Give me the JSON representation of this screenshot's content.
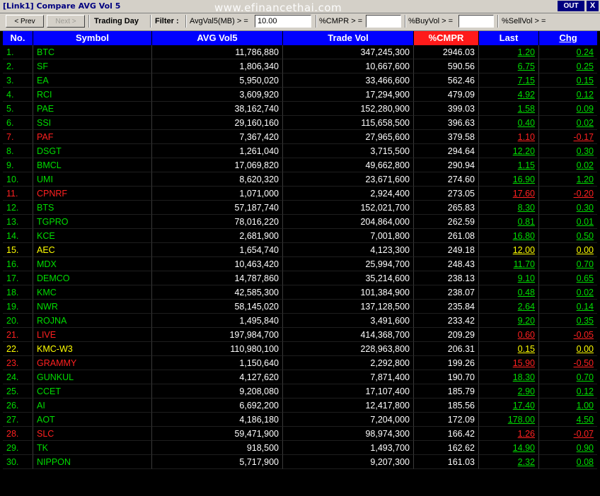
{
  "window": {
    "title": "[Link1] Compare AVG Vol 5",
    "watermark": "www.efinancethai.com",
    "out_label": "OUT",
    "close_label": "X"
  },
  "toolbar": {
    "prev_label": "< Prev",
    "next_label": "Next >",
    "trading_day_label": "Trading Day",
    "filter_label": "Filter :",
    "avgvol_label": "AvgVal5(MB) > =",
    "avgvol_value": "10.00",
    "cmpr_label": "%CMPR > =",
    "cmpr_value": "",
    "buyvol_label": "%BuyVol > =",
    "buyvol_value": "",
    "sellvol_label": "%SellVol > =",
    "sellvol_value": ""
  },
  "colors": {
    "header_bg": "#0000ff",
    "cmpr_header_bg": "#ff1a1a",
    "green": "#00dd00",
    "red": "#ff2020",
    "yellow": "#ffff00"
  },
  "table": {
    "headers": {
      "no": "No.",
      "symbol": "Symbol",
      "avg_vol5": "AVG Vol5",
      "trade_vol": "Trade Vol",
      "cmpr": "%CMPR",
      "last": "Last",
      "chg": "Chg"
    },
    "rows": [
      {
        "no": "1.",
        "symbol": "BTC",
        "avg": "11,786,880",
        "trade": "347,245,300",
        "cmpr": "2946.03",
        "last": "1.20",
        "chg": "0.24",
        "color": "green"
      },
      {
        "no": "2.",
        "symbol": "SF",
        "avg": "1,806,340",
        "trade": "10,667,600",
        "cmpr": "590.56",
        "last": "6.75",
        "chg": "0.25",
        "color": "green"
      },
      {
        "no": "3.",
        "symbol": "EA",
        "avg": "5,950,020",
        "trade": "33,466,600",
        "cmpr": "562.46",
        "last": "7.15",
        "chg": "0.15",
        "color": "green"
      },
      {
        "no": "4.",
        "symbol": "RCI",
        "avg": "3,609,920",
        "trade": "17,294,900",
        "cmpr": "479.09",
        "last": "4.92",
        "chg": "0.12",
        "color": "green"
      },
      {
        "no": "5.",
        "symbol": "PAE",
        "avg": "38,162,740",
        "trade": "152,280,900",
        "cmpr": "399.03",
        "last": "1.58",
        "chg": "0.09",
        "color": "green"
      },
      {
        "no": "6.",
        "symbol": "SSI",
        "avg": "29,160,160",
        "trade": "115,658,500",
        "cmpr": "396.63",
        "last": "0.40",
        "chg": "0.02",
        "color": "green"
      },
      {
        "no": "7.",
        "symbol": "PAF",
        "avg": "7,367,420",
        "trade": "27,965,600",
        "cmpr": "379.58",
        "last": "1.10",
        "chg": "-0.17",
        "color": "red"
      },
      {
        "no": "8.",
        "symbol": "DSGT",
        "avg": "1,261,040",
        "trade": "3,715,500",
        "cmpr": "294.64",
        "last": "12.20",
        "chg": "0.30",
        "color": "green"
      },
      {
        "no": "9.",
        "symbol": "BMCL",
        "avg": "17,069,820",
        "trade": "49,662,800",
        "cmpr": "290.94",
        "last": "1.15",
        "chg": "0.02",
        "color": "green"
      },
      {
        "no": "10.",
        "symbol": "UMI",
        "avg": "8,620,320",
        "trade": "23,671,600",
        "cmpr": "274.60",
        "last": "16.90",
        "chg": "1.20",
        "color": "green"
      },
      {
        "no": "11.",
        "symbol": "CPNRF",
        "avg": "1,071,000",
        "trade": "2,924,400",
        "cmpr": "273.05",
        "last": "17.60",
        "chg": "-0.20",
        "color": "red"
      },
      {
        "no": "12.",
        "symbol": "BTS",
        "avg": "57,187,740",
        "trade": "152,021,700",
        "cmpr": "265.83",
        "last": "8.30",
        "chg": "0.30",
        "color": "green"
      },
      {
        "no": "13.",
        "symbol": "TGPRO",
        "avg": "78,016,220",
        "trade": "204,864,000",
        "cmpr": "262.59",
        "last": "0.81",
        "chg": "0.01",
        "color": "green"
      },
      {
        "no": "14.",
        "symbol": "KCE",
        "avg": "2,681,900",
        "trade": "7,001,800",
        "cmpr": "261.08",
        "last": "16.80",
        "chg": "0.50",
        "color": "green"
      },
      {
        "no": "15.",
        "symbol": "AEC",
        "avg": "1,654,740",
        "trade": "4,123,300",
        "cmpr": "249.18",
        "last": "12.00",
        "chg": "0.00",
        "color": "yellow"
      },
      {
        "no": "16.",
        "symbol": "MDX",
        "avg": "10,463,420",
        "trade": "25,994,700",
        "cmpr": "248.43",
        "last": "11.70",
        "chg": "0.70",
        "color": "green"
      },
      {
        "no": "17.",
        "symbol": "DEMCO",
        "avg": "14,787,860",
        "trade": "35,214,600",
        "cmpr": "238.13",
        "last": "9.10",
        "chg": "0.65",
        "color": "green"
      },
      {
        "no": "18.",
        "symbol": "KMC",
        "avg": "42,585,300",
        "trade": "101,384,900",
        "cmpr": "238.07",
        "last": "0.48",
        "chg": "0.02",
        "color": "green"
      },
      {
        "no": "19.",
        "symbol": "NWR",
        "avg": "58,145,020",
        "trade": "137,128,500",
        "cmpr": "235.84",
        "last": "2.64",
        "chg": "0.14",
        "color": "green"
      },
      {
        "no": "20.",
        "symbol": "ROJNA",
        "avg": "1,495,840",
        "trade": "3,491,600",
        "cmpr": "233.42",
        "last": "9.20",
        "chg": "0.35",
        "color": "green"
      },
      {
        "no": "21.",
        "symbol": "LIVE",
        "avg": "197,984,700",
        "trade": "414,368,700",
        "cmpr": "209.29",
        "last": "0.60",
        "chg": "-0.05",
        "color": "red"
      },
      {
        "no": "22.",
        "symbol": "KMC-W3",
        "avg": "110,980,100",
        "trade": "228,963,800",
        "cmpr": "206.31",
        "last": "0.15",
        "chg": "0.00",
        "color": "yellow"
      },
      {
        "no": "23.",
        "symbol": "GRAMMY",
        "avg": "1,150,640",
        "trade": "2,292,800",
        "cmpr": "199.26",
        "last": "15.90",
        "chg": "-0.50",
        "color": "red"
      },
      {
        "no": "24.",
        "symbol": "GUNKUL",
        "avg": "4,127,620",
        "trade": "7,871,400",
        "cmpr": "190.70",
        "last": "18.30",
        "chg": "0.70",
        "color": "green"
      },
      {
        "no": "25.",
        "symbol": "CCET",
        "avg": "9,208,080",
        "trade": "17,107,400",
        "cmpr": "185.79",
        "last": "2.90",
        "chg": "0.12",
        "color": "green"
      },
      {
        "no": "26.",
        "symbol": "AI",
        "avg": "6,692,200",
        "trade": "12,417,800",
        "cmpr": "185.56",
        "last": "17.40",
        "chg": "1.00",
        "color": "green"
      },
      {
        "no": "27.",
        "symbol": "AOT",
        "avg": "4,186,180",
        "trade": "7,204,000",
        "cmpr": "172.09",
        "last": "178.00",
        "chg": "4.50",
        "color": "green"
      },
      {
        "no": "28.",
        "symbol": "SLC",
        "avg": "59,471,900",
        "trade": "98,974,300",
        "cmpr": "166.42",
        "last": "1.26",
        "chg": "-0.07",
        "color": "red"
      },
      {
        "no": "29.",
        "symbol": "TK",
        "avg": "918,500",
        "trade": "1,493,700",
        "cmpr": "162.62",
        "last": "14.90",
        "chg": "0.90",
        "color": "green"
      },
      {
        "no": "30.",
        "symbol": "NIPPON",
        "avg": "5,717,900",
        "trade": "9,207,300",
        "cmpr": "161.03",
        "last": "2.32",
        "chg": "0.08",
        "color": "green"
      }
    ]
  }
}
